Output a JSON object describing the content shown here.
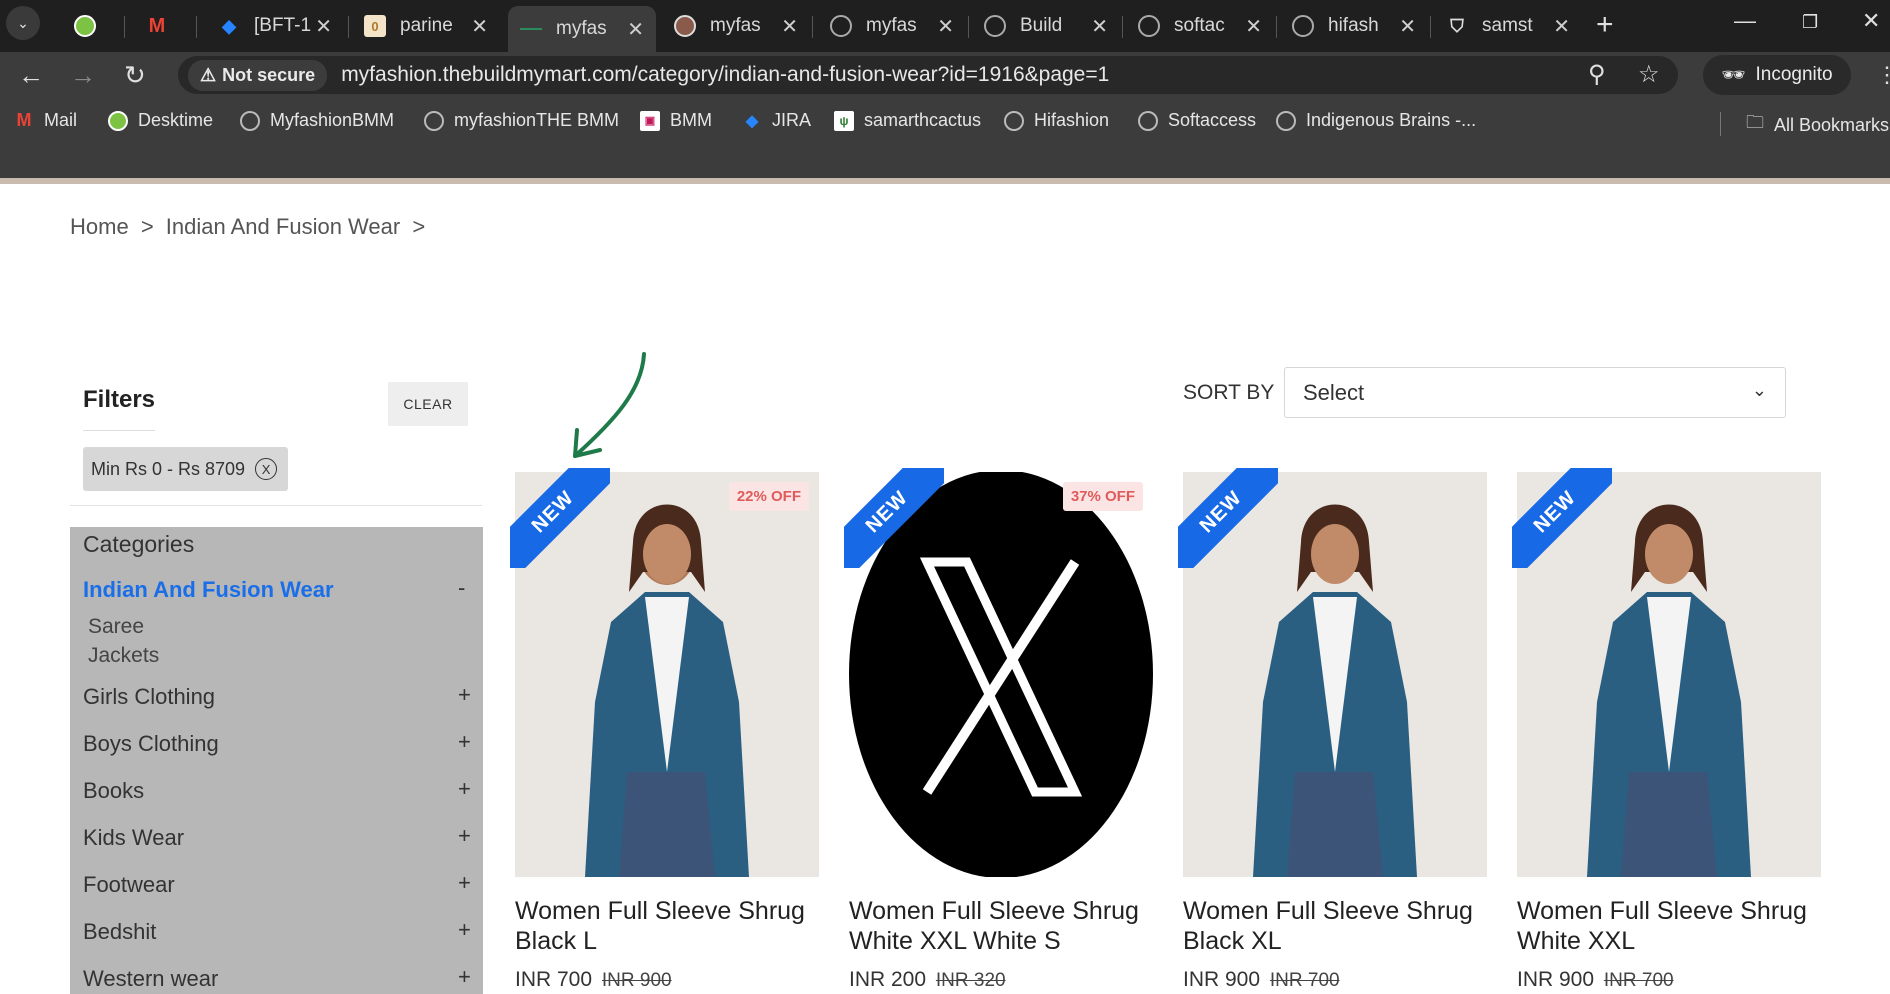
{
  "browser": {
    "tabs": [
      {
        "title": "",
        "icon": "desktime-icon"
      },
      {
        "title": "",
        "icon": "gmail-icon"
      },
      {
        "title": "[BFT-1",
        "icon": "jira-icon"
      },
      {
        "title": "parine",
        "icon": "doc-icon"
      },
      {
        "title": "myfas",
        "icon": "dash-icon",
        "active": true
      },
      {
        "title": "myfas",
        "icon": "avatar-icon"
      },
      {
        "title": "myfas",
        "icon": "globe-icon"
      },
      {
        "title": "Build",
        "icon": "globe-icon"
      },
      {
        "title": "softac",
        "icon": "globe-icon"
      },
      {
        "title": "hifash",
        "icon": "globe-icon"
      },
      {
        "title": "samst",
        "icon": "shield-icon"
      }
    ],
    "security_label": "Not secure",
    "url": "myfashion.thebuildmymart.com/category/indian-and-fusion-wear?id=1916&page=1",
    "incognito_label": "Incognito",
    "bookmarks": [
      {
        "label": "Mail",
        "icon": "gmail-icon"
      },
      {
        "label": "Desktime",
        "icon": "desktime-icon"
      },
      {
        "label": "MyfashionBMM",
        "icon": "globe-icon"
      },
      {
        "label": "myfashionTHE BMM",
        "icon": "globe-icon"
      },
      {
        "label": "BMM",
        "icon": "bmm-icon"
      },
      {
        "label": "JIRA",
        "icon": "jira-icon"
      },
      {
        "label": "samarthcactus",
        "icon": "cactus-icon"
      },
      {
        "label": "Hifashion",
        "icon": "globe-icon"
      },
      {
        "label": "Softaccess",
        "icon": "globe-icon"
      },
      {
        "label": "Indigenous Brains -...",
        "icon": "globe-icon"
      }
    ],
    "all_bookmarks_label": "All Bookmarks"
  },
  "breadcrumb": {
    "home": "Home",
    "sep1": ">",
    "current": "Indian And Fusion Wear",
    "sep2": ">"
  },
  "filters": {
    "title": "Filters",
    "clear_label": "CLEAR",
    "price_chip": "Min Rs 0 - Rs 8709",
    "chip_close": "X"
  },
  "categories": {
    "heading": "Categories",
    "active": "Indian And Fusion Wear",
    "active_toggle": "-",
    "subcategories": [
      "Saree",
      "Jackets"
    ],
    "items": [
      {
        "label": "Girls Clothing",
        "toggle": "+"
      },
      {
        "label": "Boys Clothing",
        "toggle": "+"
      },
      {
        "label": "Books",
        "toggle": "+"
      },
      {
        "label": "Kids Wear",
        "toggle": "+"
      },
      {
        "label": "Footwear",
        "toggle": "+"
      },
      {
        "label": "Bedshit",
        "toggle": "+"
      },
      {
        "label": "Western wear",
        "toggle": "+"
      }
    ]
  },
  "sort": {
    "label": "SORT BY",
    "selected": "Select"
  },
  "products": [
    {
      "badge": "NEW",
      "discount": "22% OFF",
      "name": "Women Full Sleeve Shrug Black L",
      "price": "INR 700",
      "old_price": "INR 900",
      "image": "model-shrug"
    },
    {
      "badge": "NEW",
      "discount": "37% OFF",
      "name": "Women Full Sleeve Shrug White XXL White S",
      "price": "INR 200",
      "old_price": "INR 320",
      "image": "x-logo"
    },
    {
      "badge": "NEW",
      "discount": "",
      "name": "Women Full Sleeve Shrug Black XL",
      "price": "INR 900",
      "old_price": "INR 700",
      "image": "model-shrug"
    },
    {
      "badge": "NEW",
      "discount": "",
      "name": "Women Full Sleeve Shrug White XXL",
      "price": "INR 900",
      "old_price": "INR 700",
      "image": "model-shrug"
    }
  ],
  "colors": {
    "accent_blue": "#1769e5",
    "category_panel": "#b7b7b7",
    "discount_text": "#e05b5b",
    "annotation_green": "#1f7a4a"
  }
}
